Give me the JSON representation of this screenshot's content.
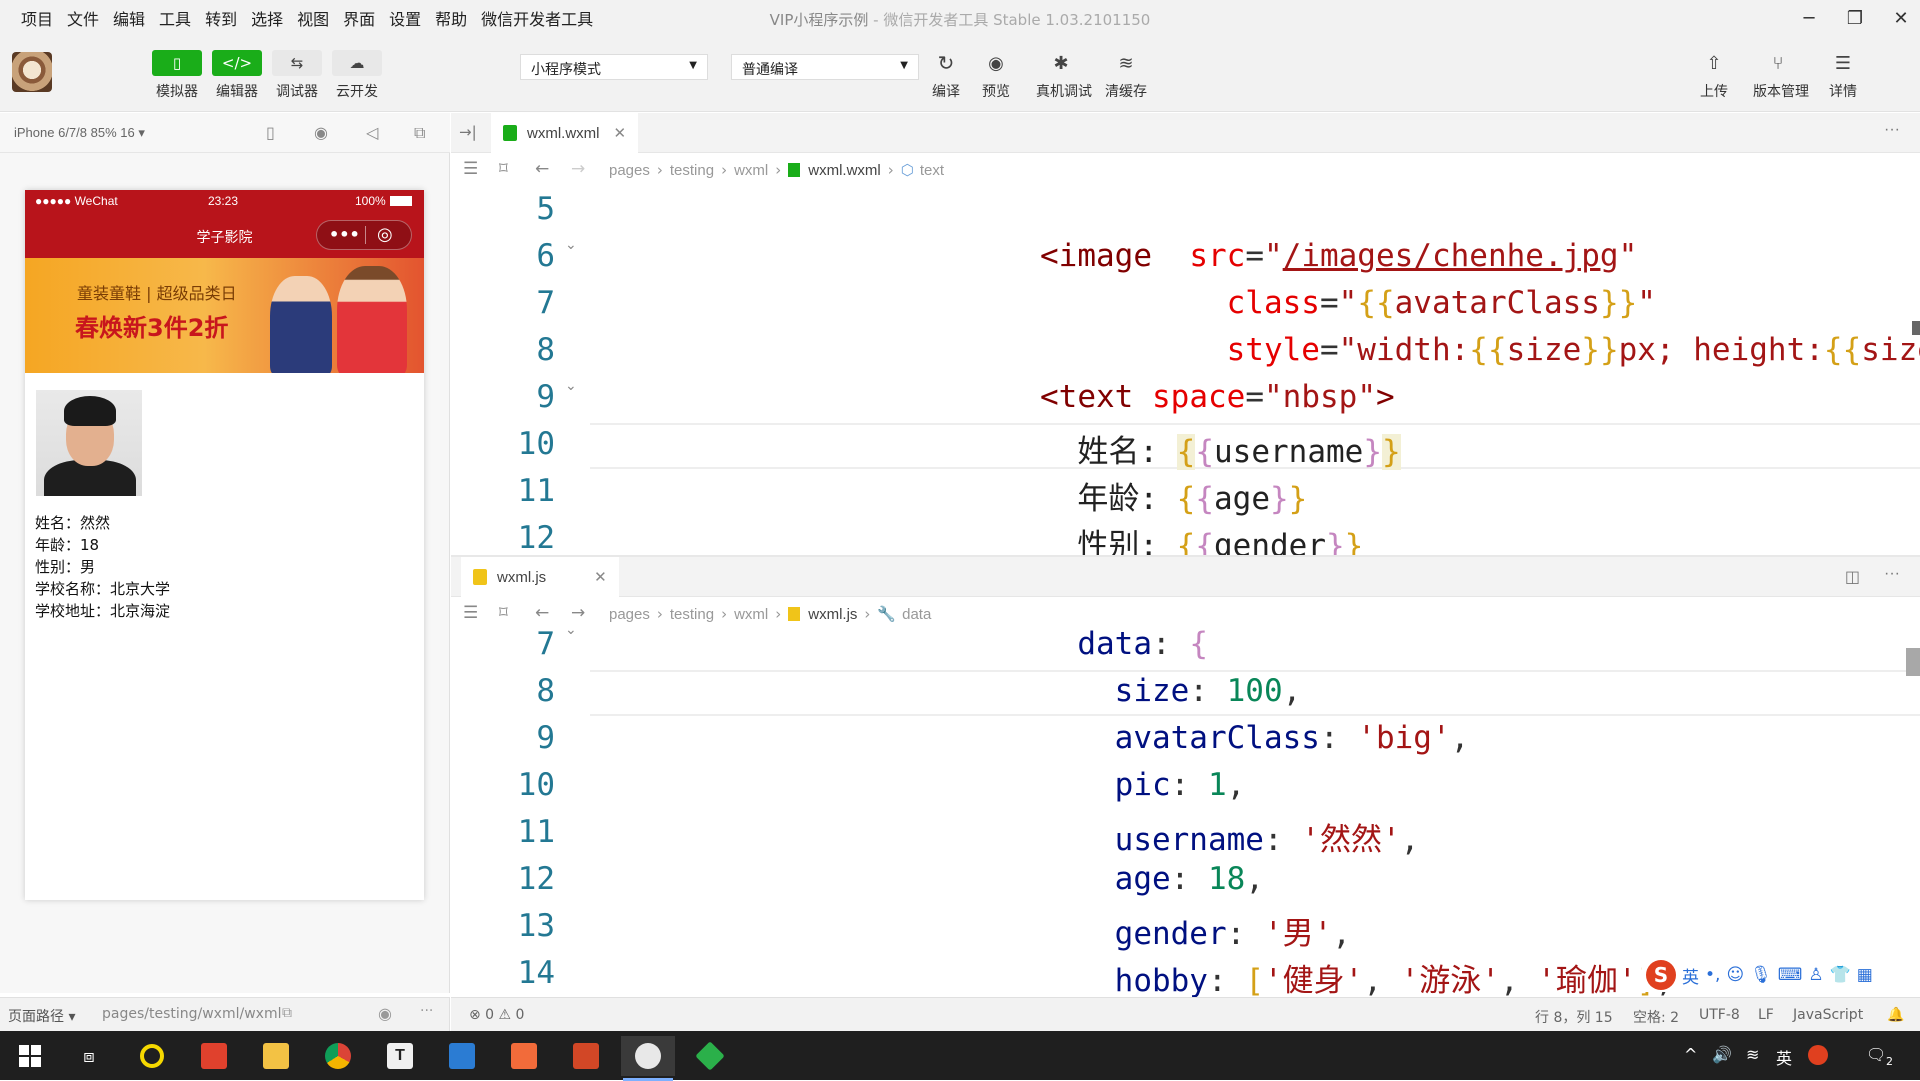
{
  "menubar": {
    "items": [
      "项目",
      "文件",
      "编辑",
      "工具",
      "转到",
      "选择",
      "视图",
      "界面",
      "设置",
      "帮助",
      "微信开发者工具"
    ],
    "title_main": "VIP小程序示例",
    "title_sub": " - 微信开发者工具 Stable 1.03.2101150"
  },
  "toolbar": {
    "left_buttons": [
      {
        "label": "模拟器",
        "icon": "phone-icon",
        "glyph": "▯"
      },
      {
        "label": "编辑器",
        "icon": "code-icon",
        "glyph": "</>"
      },
      {
        "label": "调试器",
        "icon": "debug-icon",
        "glyph": "⇆"
      },
      {
        "label": "云开发",
        "icon": "cloud-icon",
        "glyph": "☁"
      }
    ],
    "mode_select": "小程序模式",
    "compile_select": "普通编译",
    "mid_buttons": [
      {
        "label": "编译",
        "icon": "refresh-icon",
        "glyph": "↻"
      },
      {
        "label": "预览",
        "icon": "eye-icon",
        "glyph": "◉"
      },
      {
        "label": "真机调试",
        "icon": "bug-icon",
        "glyph": "✱"
      },
      {
        "label": "清缓存",
        "icon": "layers-icon",
        "glyph": "≋"
      }
    ],
    "right_buttons": [
      {
        "label": "上传",
        "icon": "upload-icon",
        "glyph": "⇧"
      },
      {
        "label": "版本管理",
        "icon": "branch-icon",
        "glyph": "⑂"
      },
      {
        "label": "详情",
        "icon": "menu-icon",
        "glyph": "☰"
      }
    ]
  },
  "simulator": {
    "device": "iPhone 6/7/8 85% 16 ▾",
    "status_left": "●●●●● WeChat",
    "status_time": "23:23",
    "status_battery": "100%",
    "nav_title": "学子影院",
    "banner_line1": "童装童鞋 | 超级品类日",
    "banner_line2": "春焕新3件2折",
    "info_lines": [
      "姓名：然然",
      "年龄：18",
      "性别：男",
      "学校名称：北京大学",
      "学校地址：北京海淀"
    ]
  },
  "sim_footer": {
    "label": "页面路径 ▾",
    "path": "pages/testing/wxml/wxml"
  },
  "editor_top": {
    "tab": "wxml.wxml",
    "crumbs": [
      "pages",
      "testing",
      "wxml",
      "wxml.wxml",
      "text"
    ],
    "lines": [
      {
        "n": "5",
        "text": ""
      },
      {
        "n": "6",
        "text": "<image  src=\"/images/chenhe.jpg\""
      },
      {
        "n": "7",
        "text": "        class=\"{{avatarClass}}\""
      },
      {
        "n": "8",
        "text": "        style=\"width:{{size}}px; height:{{size}}px;\"></image>"
      },
      {
        "n": "9",
        "text": "<text space=\"nbsp\">"
      },
      {
        "n": "10",
        "text": "  姓名: {{username}}"
      },
      {
        "n": "11",
        "text": "  年龄: {{age}}"
      },
      {
        "n": "12",
        "text": "  性别: {{gender}}"
      }
    ]
  },
  "editor_bottom": {
    "tab": "wxml.js",
    "crumbs": [
      "pages",
      "testing",
      "wxml",
      "wxml.js",
      "data"
    ],
    "lines": [
      {
        "n": "7",
        "text": "  data: {"
      },
      {
        "n": "8",
        "text": "    size: 100,"
      },
      {
        "n": "9",
        "text": "    avatarClass: 'big',"
      },
      {
        "n": "10",
        "text": "    pic: 1,"
      },
      {
        "n": "11",
        "text": "    username: '然然',"
      },
      {
        "n": "12",
        "text": "    age: 18,"
      },
      {
        "n": "13",
        "text": "    gender: '男',"
      },
      {
        "n": "14",
        "text": "    hobby: ['健身', '游泳', '瑜伽'],"
      }
    ]
  },
  "statusbar": {
    "problems": "⊗ 0 ⚠ 0",
    "position": "行 8，列 15",
    "spaces": "空格: 2",
    "encoding": "UTF-8",
    "eol": "LF",
    "language": "JavaScript"
  },
  "ime": {
    "lang": "英"
  },
  "taskbar": {
    "tray_lang": "英",
    "notif_count": "2"
  },
  "colors": {
    "accent_green": "#1aad19",
    "wechat_red": "#b8141b",
    "line_number": "#237893"
  }
}
